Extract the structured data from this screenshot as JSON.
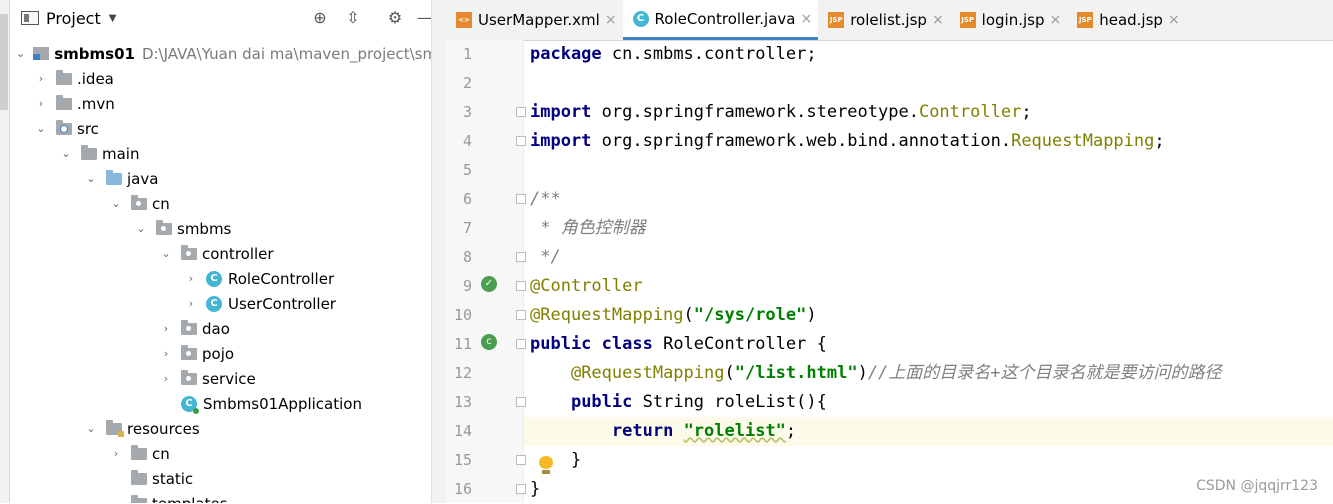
{
  "project_panel": {
    "title": "Project",
    "tree": [
      {
        "label": "smbms01",
        "path": "D:\\JAVA\\Yuan dai ma\\maven_project\\smbms",
        "icon": "module-icon",
        "bold": true
      },
      {
        "label": ".idea",
        "icon": "folder-icon"
      },
      {
        "label": ".mvn",
        "icon": "folder-icon"
      },
      {
        "label": "src",
        "icon": "source-folder-icon"
      },
      {
        "label": "main",
        "icon": "folder-icon"
      },
      {
        "label": "java",
        "icon": "source-root-folder-icon"
      },
      {
        "label": "cn",
        "icon": "package-icon"
      },
      {
        "label": "smbms",
        "icon": "package-icon"
      },
      {
        "label": "controller",
        "icon": "package-icon"
      },
      {
        "label": "RoleController",
        "icon": "class-icon"
      },
      {
        "label": "UserController",
        "icon": "class-icon"
      },
      {
        "label": "dao",
        "icon": "package-icon"
      },
      {
        "label": "pojo",
        "icon": "package-icon"
      },
      {
        "label": "service",
        "icon": "package-icon"
      },
      {
        "label": "Smbms01Application",
        "icon": "spring-app-icon"
      },
      {
        "label": "resources",
        "icon": "resources-folder-icon"
      },
      {
        "label": "cn",
        "icon": "folder-icon"
      },
      {
        "label": "static",
        "icon": "folder-icon"
      },
      {
        "label": "templates",
        "icon": "folder-icon"
      }
    ]
  },
  "tabs": [
    {
      "label": "UserMapper.xml",
      "icon": "xml-file-icon",
      "active": false,
      "close": "×"
    },
    {
      "label": "RoleController.java",
      "icon": "java-class-icon",
      "active": true,
      "close": "×"
    },
    {
      "label": "rolelist.jsp",
      "icon": "jsp-file-icon",
      "active": false,
      "close": "×"
    },
    {
      "label": "login.jsp",
      "icon": "jsp-file-icon",
      "active": false,
      "close": "×"
    },
    {
      "label": "head.jsp",
      "icon": "jsp-file-icon",
      "active": false,
      "close": "×"
    }
  ],
  "editor": {
    "current_line": 14,
    "line_numbers": [
      "1",
      "2",
      "3",
      "4",
      "5",
      "6",
      "7",
      "8",
      "9",
      "10",
      "11",
      "12",
      "13",
      "14",
      "15",
      "16"
    ],
    "lines": [
      "package cn.smbms.controller;",
      "",
      "import org.springframework.stereotype.Controller;",
      "import org.springframework.web.bind.annotation.RequestMapping;",
      "",
      "/**",
      " * 角色控制器",
      " */",
      "@Controller",
      "@RequestMapping(\"/sys/role\")",
      "public class RoleController {",
      "    @RequestMapping(\"/list.html\")//上面的目录名+这个目录名就是要访问的路径",
      "    public String roleList(){",
      "        return \"rolelist\";",
      "    }",
      "}"
    ]
  },
  "watermark": "CSDN @jqqjrr123",
  "colors": {
    "keyword": "#000080",
    "annotation": "#808000",
    "string": "#008000",
    "comment": "#808080",
    "active_tab_underline": "#4083c9"
  }
}
